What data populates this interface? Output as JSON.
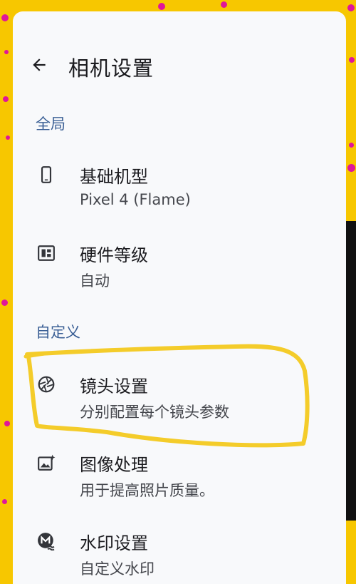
{
  "header": {
    "title": "相机设置",
    "back_icon": "arrow-left-icon"
  },
  "sections": [
    {
      "label": "全局"
    },
    {
      "label": "自定义"
    }
  ],
  "items": [
    {
      "icon": "smartphone-icon",
      "title": "基础机型",
      "subtitle": "Pixel 4 (Flame)"
    },
    {
      "icon": "chip-icon",
      "title": "硬件等级",
      "subtitle": "自动"
    },
    {
      "icon": "camera-aperture-icon",
      "title": "镜头设置",
      "subtitle": "分别配置每个镜头参数"
    },
    {
      "icon": "image-sparkle-icon",
      "title": "图像处理",
      "subtitle": "用于提高照片质量。"
    },
    {
      "icon": "watermark-icon",
      "title": "水印设置",
      "subtitle": "自定义水印"
    }
  ],
  "colors": {
    "accent": "#3a5f95",
    "background_frame": "#f7c700",
    "highlight_stroke": "#f4cc2a",
    "dots": "#e0169a"
  }
}
